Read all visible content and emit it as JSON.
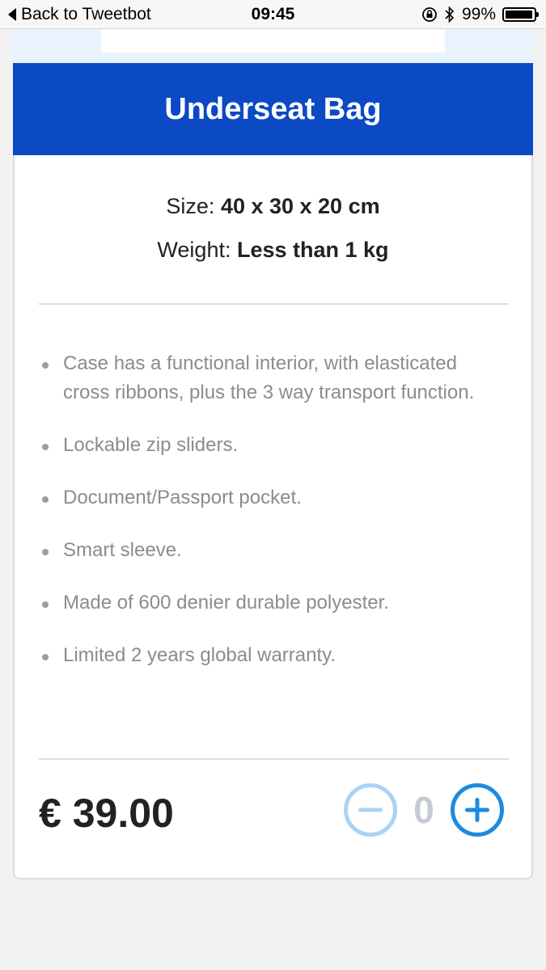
{
  "status_bar": {
    "back_label": "Back to Tweetbot",
    "time": "09:45",
    "battery": "99%",
    "battery_level": 0.99
  },
  "product": {
    "title": "Underseat Bag",
    "size_label": "Size:",
    "size_value": "40 x 30 x 20 cm",
    "weight_label": "Weight:",
    "weight_value": "Less than 1 kg",
    "features": [
      "Case has a functional interior, with elasticated cross ribbons, plus the 3 way transport function.",
      "Lockable zip sliders.",
      "Document/Passport pocket.",
      "Smart sleeve.",
      "Made of 600 denier durable polyester.",
      "Limited 2 years global warranty."
    ],
    "price": "€ 39.00",
    "quantity": "0"
  },
  "colors": {
    "header_bg": "#0c49c4",
    "plus_accent": "#1a8be0",
    "minus_accent_disabled": "#a9d3f6"
  }
}
